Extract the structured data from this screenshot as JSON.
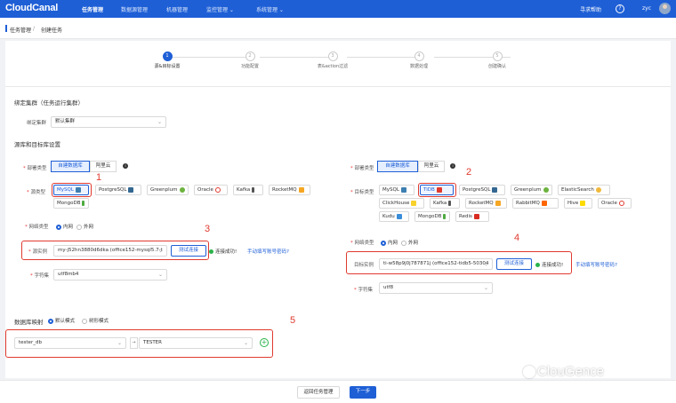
{
  "nav": {
    "logo": "CloudCanal",
    "items": [
      "任务管理",
      "数据源管理",
      "机器管理",
      "监控管理 ⌄",
      "系统管理 ⌄"
    ],
    "help": "寻求帮助",
    "help_icon": "?",
    "user": "zyc"
  },
  "breadcrumb": [
    "任务管理",
    "/",
    "创建任务"
  ],
  "steps": [
    {
      "num": "1",
      "label": "源&目标设置"
    },
    {
      "num": "2",
      "label": "功能配置"
    },
    {
      "num": "3",
      "label": "表&action过滤"
    },
    {
      "num": "4",
      "label": "数据处理"
    },
    {
      "num": "5",
      "label": "创建确认"
    }
  ],
  "cluster": {
    "section_title": "绑定集群（任务运行集群）",
    "label": "绑定集群",
    "value": "默认集群"
  },
  "source_target_title": "源库和目标库设置",
  "source": {
    "deploy_label": "部署类型",
    "deploy_options": [
      "自建数据库",
      "阿里云"
    ],
    "type_label": "源类型",
    "types": [
      "MySQL",
      "PostgreSQL",
      "Greenplum",
      "Oracle",
      "Kafka",
      "RocketMQ",
      "MongoDB"
    ],
    "net_label": "网络类型",
    "net_options": [
      "内网",
      "外网"
    ],
    "instance_label": "源实例",
    "instance_value": "my-j52hn3880d6dka (office152-mysql5.7-t",
    "test_button": "测试连接",
    "ok_text": "连接成功!",
    "manual_link": "手动填写账号密码?",
    "charset_label": "字符集",
    "charset_value": "utf8mb4"
  },
  "target": {
    "deploy_label": "部署类型",
    "deploy_options": [
      "自建数据库",
      "阿里云"
    ],
    "type_label": "目标类型",
    "types": [
      "MySQL",
      "TiDB",
      "PostgreSQL",
      "Greenplum",
      "ElasticSearch",
      "ClickHouse",
      "Kafka",
      "RocketMQ",
      "RabbitMQ",
      "Hive",
      "Oracle",
      "Kudu",
      "MongoDB",
      "Redis"
    ],
    "net_label": "网络类型",
    "net_options": [
      "内网",
      "外网"
    ],
    "instance_label": "目标实例",
    "instance_value": "ti-w58p9j0j787871j (office152-tidb5-50304",
    "test_button": "测试连接",
    "ok_text": "连接成功!",
    "manual_link": "手动填写账号密码?",
    "charset_label": "字符集",
    "charset_value": "utf8"
  },
  "mapping": {
    "label": "数据库映射",
    "options": [
      "默认模式",
      "树形模式"
    ],
    "source_db": "tester_db",
    "target_db": "TESTER",
    "arrow": "→",
    "add": "+"
  },
  "annotations": [
    "1",
    "2",
    "3",
    "4",
    "5"
  ],
  "footer": {
    "back": "返回任务管理",
    "next": "下一步"
  },
  "watermark": "ClouGence",
  "colors": {
    "brand": "#1e5fd6",
    "annotation": "#e03a2f",
    "success": "#2ab24b"
  }
}
